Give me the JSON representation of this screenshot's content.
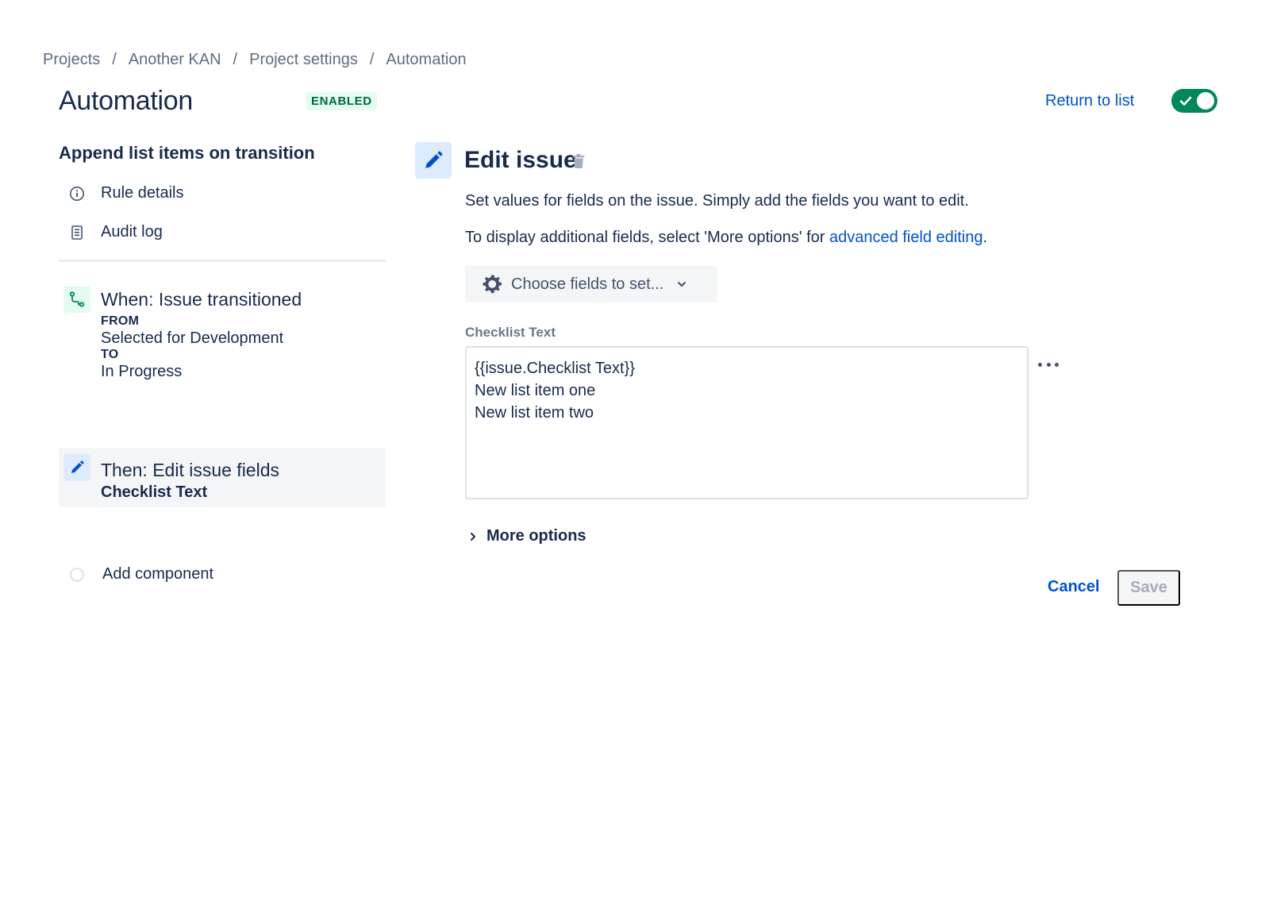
{
  "breadcrumb": {
    "items": [
      "Projects",
      "Another KAN",
      "Project settings",
      "Automation"
    ],
    "separator": "/"
  },
  "header": {
    "title": "Automation",
    "status": "ENABLED",
    "return_label": "Return to list",
    "rule_enabled": true
  },
  "sidebar": {
    "rule_name": "Append list items on transition",
    "nav": [
      {
        "label": "Rule details",
        "icon": "info-icon"
      },
      {
        "label": "Audit log",
        "icon": "document-icon"
      }
    ],
    "trigger": {
      "title": "When: Issue transitioned",
      "from_label": "FROM",
      "from_value": "Selected for Development",
      "to_label": "TO",
      "to_value": "In Progress",
      "icon": "transition-icon"
    },
    "action": {
      "title": "Then: Edit issue fields",
      "subtitle": "Checklist Text",
      "icon": "pencil-icon"
    },
    "add_component_label": "Add component"
  },
  "editor": {
    "title": "Edit issue",
    "description": "Set values for fields on the issue. Simply add the fields you want to edit.",
    "description2_prefix": "To display additional fields, select 'More options' for ",
    "description2_link": "advanced field editing",
    "description2_suffix": ".",
    "choose_fields_label": "Choose fields to set...",
    "field": {
      "label": "Checklist Text",
      "value": "{{issue.Checklist Text}}\nNew list item one\nNew list item two"
    },
    "more_options_label": "More options",
    "cancel_label": "Cancel",
    "save_label": "Save"
  },
  "colors": {
    "accent": "#0052cc",
    "success": "#00875a",
    "text": "#172b4d",
    "muted": "#5e6c84"
  }
}
